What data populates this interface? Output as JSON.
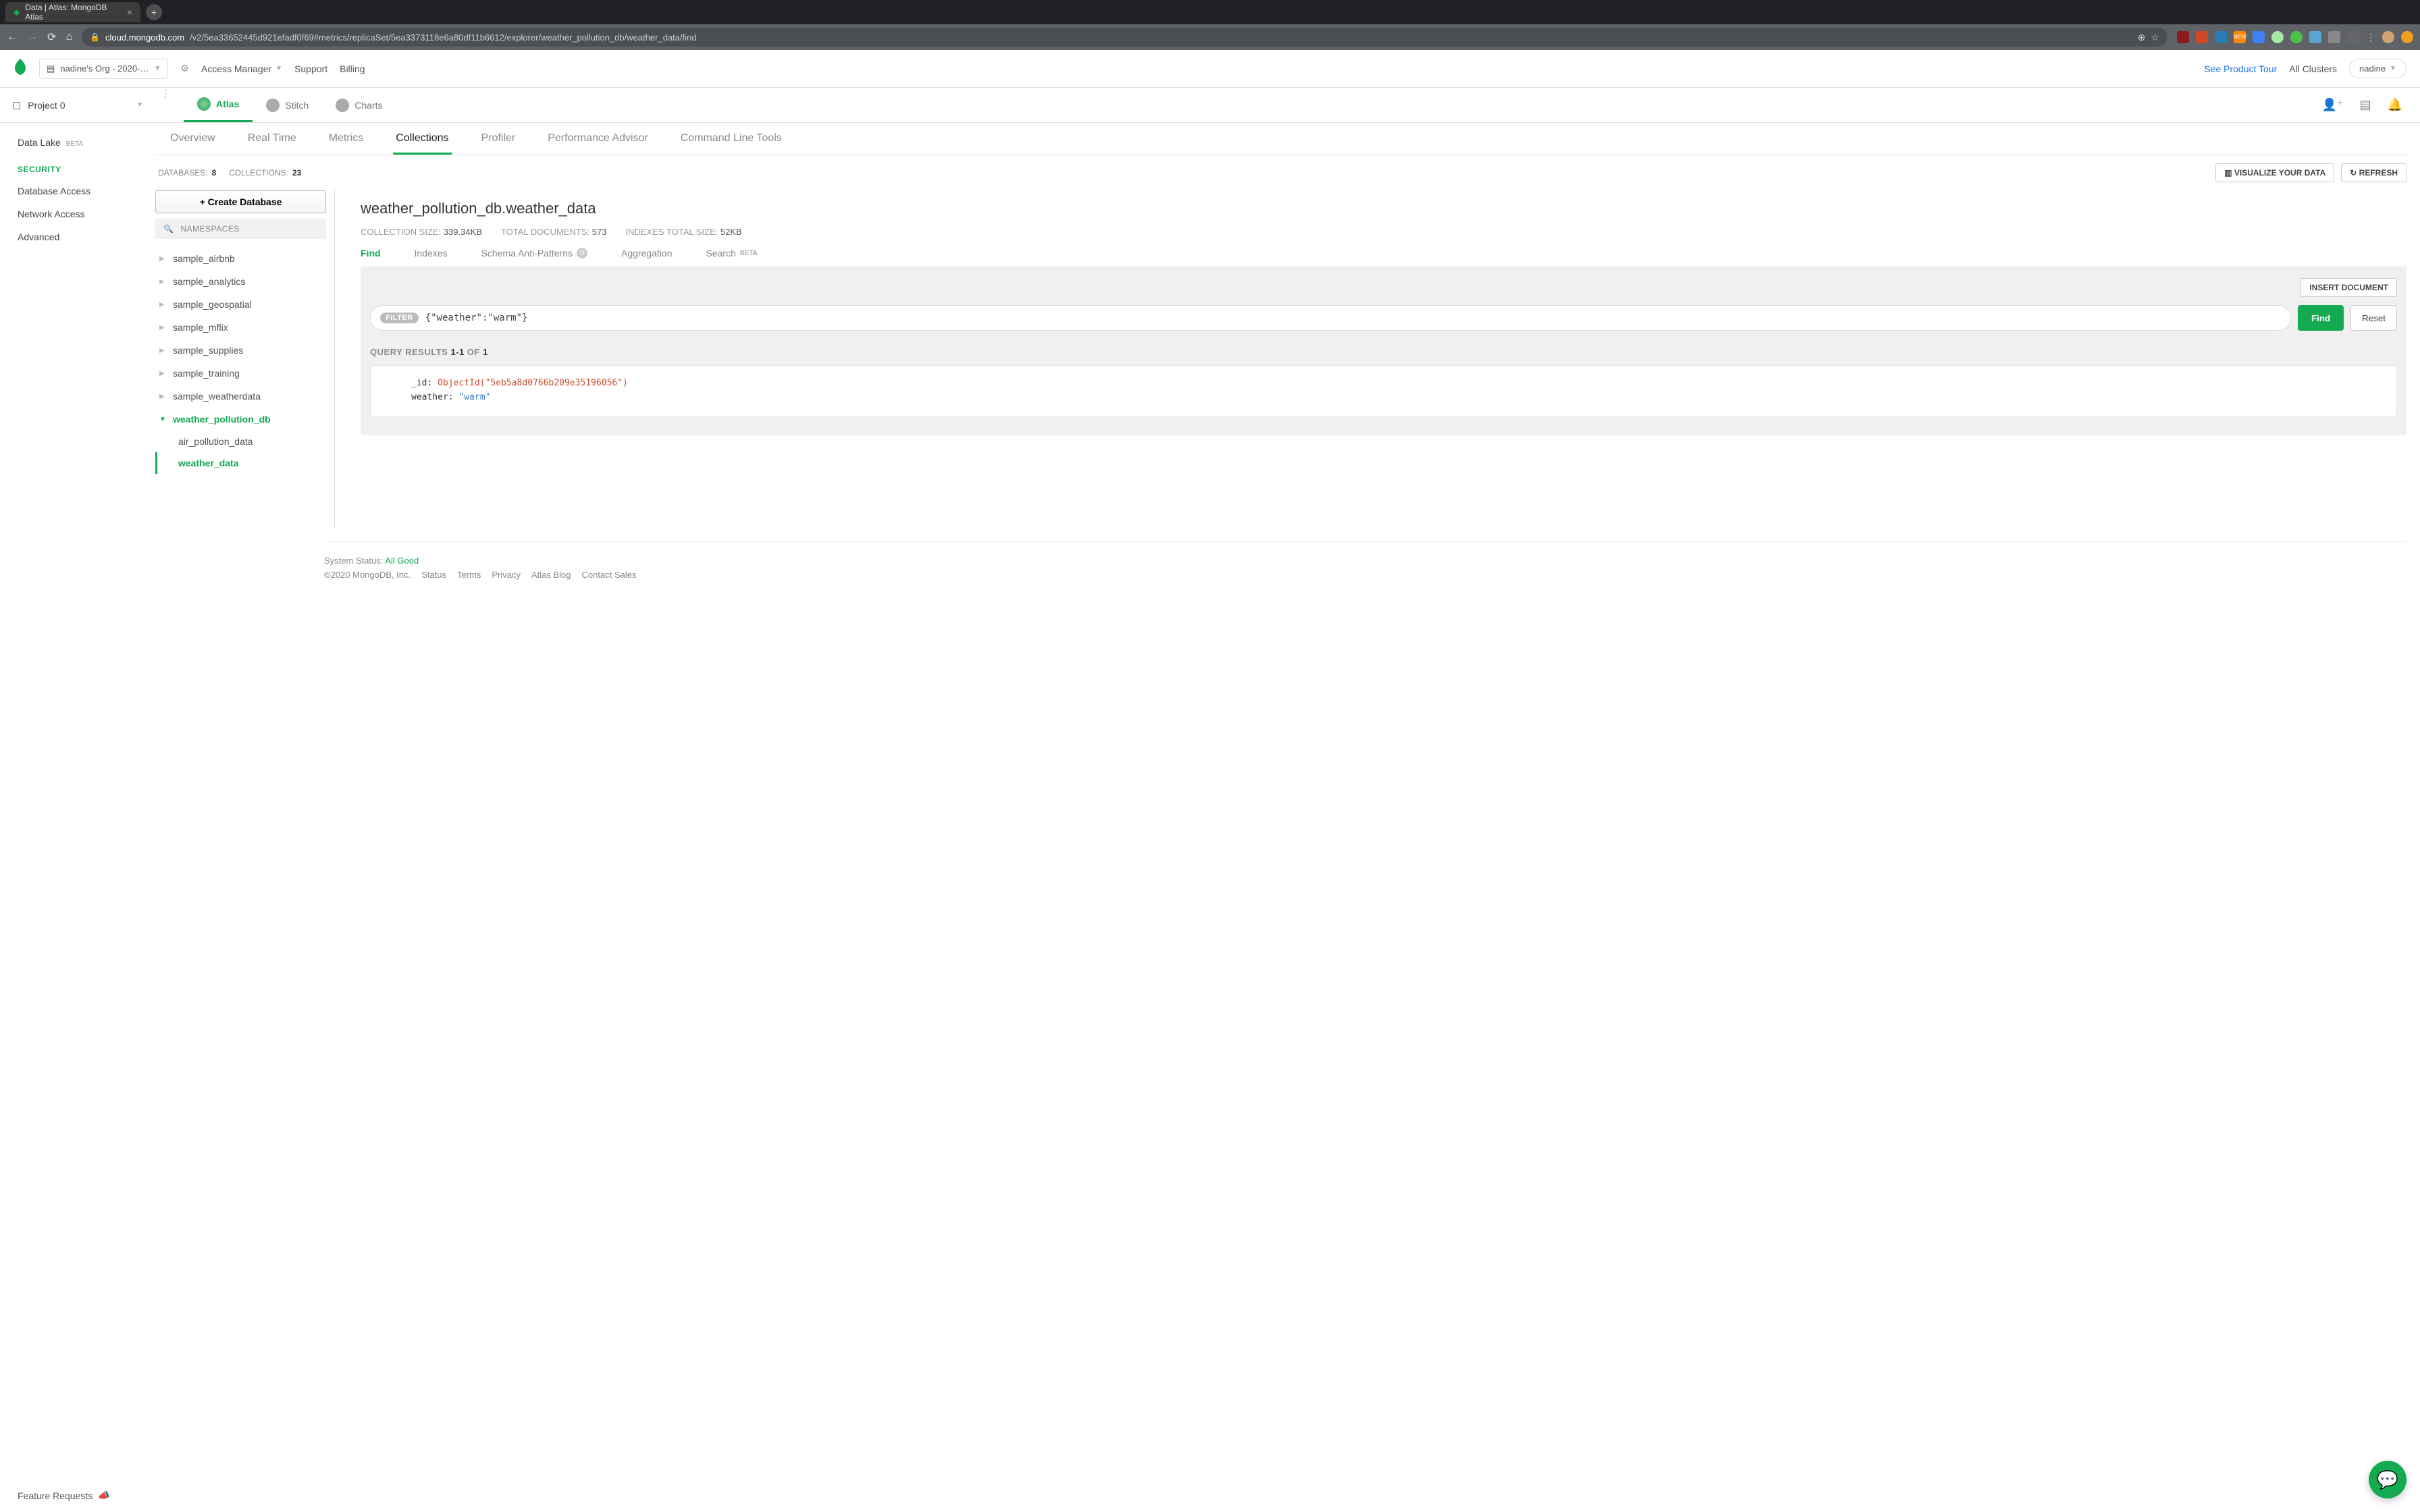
{
  "browser": {
    "tab_title": "Data | Atlas: MongoDB Atlas",
    "url_domain": "cloud.mongodb.com",
    "url_path": "/v2/5ea33652445d921efadf0f69#metrics/replicaSet/5ea3373118e6a80df11b6612/explorer/weather_pollution_db/weather_data/find"
  },
  "top": {
    "org_name": "nadine's Org - 2020-…",
    "nav": {
      "access": "Access Manager",
      "support": "Support",
      "billing": "Billing"
    },
    "tour": "See Product Tour",
    "clusters": "All Clusters",
    "user": "nadine"
  },
  "project": {
    "name": "Project 0"
  },
  "product_tabs": {
    "atlas": "Atlas",
    "stitch": "Stitch",
    "charts": "Charts"
  },
  "left_nav": {
    "datalake": "Data Lake",
    "beta": "BETA",
    "security": "SECURITY",
    "db_access": "Database Access",
    "net_access": "Network Access",
    "advanced": "Advanced"
  },
  "cluster_tabs": [
    "Overview",
    "Real Time",
    "Metrics",
    "Collections",
    "Profiler",
    "Performance Advisor",
    "Command Line Tools"
  ],
  "stats": {
    "databases_label": "DATABASES:",
    "databases": "8",
    "collections_label": "COLLECTIONS:",
    "collections": "23",
    "visualize": "VISUALIZE YOUR DATA",
    "refresh": "REFRESH"
  },
  "db_sidebar": {
    "create": "Create Database",
    "namespaces": "NAMESPACES",
    "dbs": [
      "sample_airbnb",
      "sample_analytics",
      "sample_geospatial",
      "sample_mflix",
      "sample_supplies",
      "sample_training",
      "sample_weatherdata"
    ],
    "active_db": "weather_pollution_db",
    "collections": [
      "air_pollution_data",
      "weather_data"
    ],
    "active_coll": "weather_data"
  },
  "detail": {
    "title": "weather_pollution_db.weather_data",
    "stats": {
      "size_label": "COLLECTION SIZE:",
      "size": "339.34KB",
      "docs_label": "TOTAL DOCUMENTS:",
      "docs": "573",
      "idx_label": "INDEXES TOTAL SIZE:",
      "idx": "52KB"
    },
    "tabs": {
      "find": "Find",
      "indexes": "Indexes",
      "anti": "Schema Anti-Patterns",
      "anti_count": "0",
      "agg": "Aggregation",
      "search": "Search",
      "search_beta": "BETA"
    },
    "insert": "INSERT DOCUMENT",
    "filter": {
      "pill": "FILTER",
      "text": "{\"weather\":\"warm\"}",
      "find": "Find",
      "reset": "Reset"
    },
    "results": {
      "label": "QUERY RESULTS",
      "range": "1-1",
      "of": "OF",
      "total": "1"
    },
    "doc": {
      "id_key": "_id",
      "id_val": "ObjectId(\"5eb5a8d0766b209e35196056\")",
      "weather_key": "weather",
      "weather_val": "\"warm\""
    }
  },
  "footer": {
    "status_label": "System Status:",
    "status_val": "All Good",
    "copyright": "©2020 MongoDB, Inc.",
    "links": [
      "Status",
      "Terms",
      "Privacy",
      "Atlas Blog",
      "Contact Sales"
    ]
  },
  "feature_req": "Feature Requests"
}
